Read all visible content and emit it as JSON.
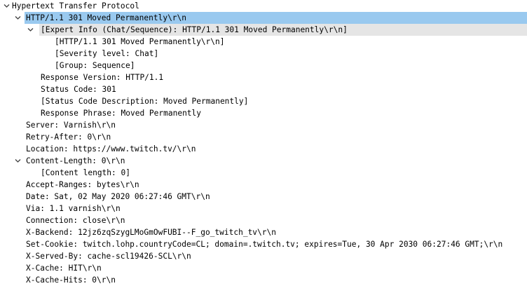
{
  "packet_details": {
    "rows": [
      {
        "text": "Hypertext Transfer Protocol",
        "indent": 0,
        "toggle": "expanded",
        "highlight": "none"
      },
      {
        "text": "HTTP/1.1 301 Moved Permanently\\r\\n",
        "indent": 1,
        "toggle": "expanded",
        "highlight": "dark"
      },
      {
        "text": "[Expert Info (Chat/Sequence): HTTP/1.1 301 Moved Permanently\\r\\n]",
        "indent": 2,
        "toggle": "expanded",
        "highlight": "light"
      },
      {
        "text": "[HTTP/1.1 301 Moved Permanently\\r\\n]",
        "indent": 3,
        "toggle": "none",
        "highlight": "none"
      },
      {
        "text": "[Severity level: Chat]",
        "indent": 3,
        "toggle": "none",
        "highlight": "none"
      },
      {
        "text": "[Group: Sequence]",
        "indent": 3,
        "toggle": "none",
        "highlight": "none"
      },
      {
        "text": "Response Version: HTTP/1.1",
        "indent": 2,
        "toggle": "none",
        "highlight": "none"
      },
      {
        "text": "Status Code: 301",
        "indent": 2,
        "toggle": "none",
        "highlight": "none"
      },
      {
        "text": "[Status Code Description: Moved Permanently]",
        "indent": 2,
        "toggle": "none",
        "highlight": "none"
      },
      {
        "text": "Response Phrase: Moved Permanently",
        "indent": 2,
        "toggle": "none",
        "highlight": "none"
      },
      {
        "text": "Server: Varnish\\r\\n",
        "indent": 1,
        "toggle": "none",
        "highlight": "none"
      },
      {
        "text": "Retry-After: 0\\r\\n",
        "indent": 1,
        "toggle": "none",
        "highlight": "none"
      },
      {
        "text": "Location: https://www.twitch.tv/\\r\\n",
        "indent": 1,
        "toggle": "none",
        "highlight": "none"
      },
      {
        "text": "Content-Length: 0\\r\\n",
        "indent": 1,
        "toggle": "expanded",
        "highlight": "none"
      },
      {
        "text": "[Content length: 0]",
        "indent": 2,
        "toggle": "none",
        "highlight": "none"
      },
      {
        "text": "Accept-Ranges: bytes\\r\\n",
        "indent": 1,
        "toggle": "none",
        "highlight": "none"
      },
      {
        "text": "Date: Sat, 02 May 2020 06:27:46 GMT\\r\\n",
        "indent": 1,
        "toggle": "none",
        "highlight": "none"
      },
      {
        "text": "Via: 1.1 varnish\\r\\n",
        "indent": 1,
        "toggle": "none",
        "highlight": "none"
      },
      {
        "text": "Connection: close\\r\\n",
        "indent": 1,
        "toggle": "none",
        "highlight": "none"
      },
      {
        "text": "X-Backend: 12jz6zqSzygLMoGmOwFUBI--F_go_twitch_tv\\r\\n",
        "indent": 1,
        "toggle": "none",
        "highlight": "none"
      },
      {
        "text": "Set-Cookie: twitch.lohp.countryCode=CL; domain=.twitch.tv; expires=Tue, 30 Apr 2030 06:27:46 GMT;\\r\\n",
        "indent": 1,
        "toggle": "none",
        "highlight": "none"
      },
      {
        "text": "X-Served-By: cache-scl19426-SCL\\r\\n",
        "indent": 1,
        "toggle": "none",
        "highlight": "none"
      },
      {
        "text": "X-Cache: HIT\\r\\n",
        "indent": 1,
        "toggle": "none",
        "highlight": "none"
      },
      {
        "text": "X-Cache-Hits: 0\\r\\n",
        "indent": 1,
        "toggle": "none",
        "highlight": "none"
      }
    ]
  },
  "colors": {
    "selected_row": "#99c9ef",
    "expert_info_row": "#e5e5e5",
    "text": "#000000",
    "toggle_arrow": "#404040"
  },
  "icons": {
    "expanded": "chevron-down-icon"
  }
}
